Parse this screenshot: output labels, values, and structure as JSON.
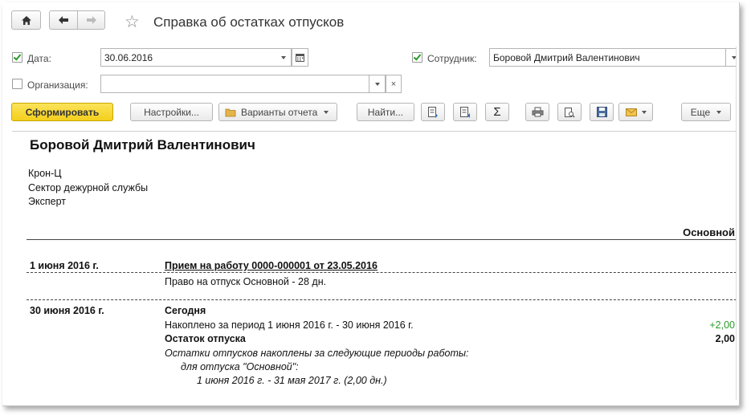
{
  "window": {
    "title": "Справка об остатках отпусков"
  },
  "filters": {
    "date_label": "Дата:",
    "date_value": "30.06.2016",
    "date_checked": true,
    "employee_label": "Сотрудник:",
    "employee_value": "Боровой Дмитрий Валентинович",
    "employee_checked": true,
    "org_label": "Организация:",
    "org_value": "",
    "org_checked": false
  },
  "toolbar": {
    "generate_label": "Сформировать",
    "settings_label": "Настройки...",
    "variants_label": "Варианты отчета",
    "find_label": "Найти...",
    "sum_symbol": "Σ",
    "more_label": "Еще"
  },
  "report": {
    "employee_name": "Боровой Дмитрий Валентинович",
    "org": "Крон-Ц",
    "department": "Сектор дежурной службы",
    "position": "Эксперт",
    "column_header": "Основной",
    "section1": {
      "date": "1 июня 2016 г.",
      "event": "Прием на работу 0000-000001 от 23.05.2016",
      "detail": "Право на отпуск Основной - 28 дн."
    },
    "section2": {
      "date": "30 июня 2016 г.",
      "today": "Сегодня",
      "accrued_text": "Накоплено за период 1 июня 2016 г. - 30 июня 2016 г.",
      "accrued_value": "+2,00",
      "balance_label": "Остаток отпуска",
      "balance_value": "2,00",
      "note1": "Остатки отпусков накоплены за следующие периоды работы:",
      "note2": "для отпуска \"Основной\":",
      "note3": "1 июня 2016 г. - 31 мая 2017 г. (2,00 дн.)"
    }
  },
  "colors": {
    "accent_green": "#2a9a2a",
    "primary_yellow": "#f4cf1c"
  }
}
